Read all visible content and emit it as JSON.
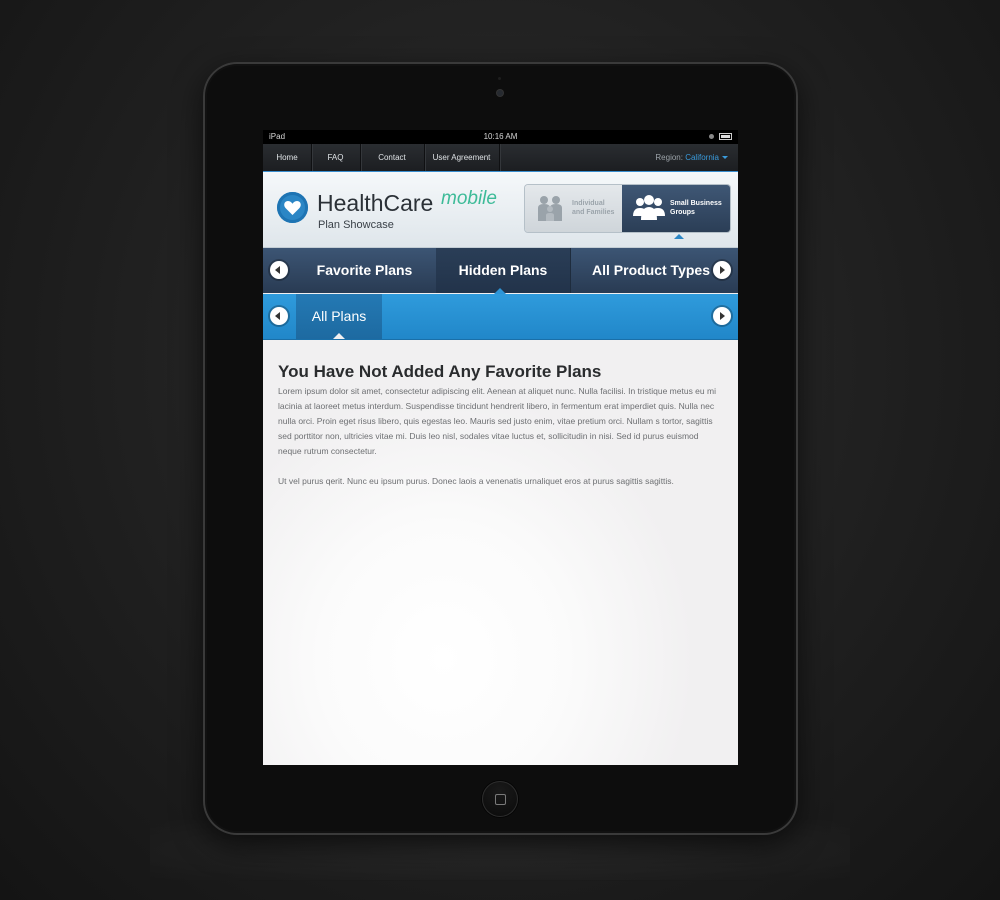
{
  "status_bar": {
    "carrier": "iPad",
    "time": "10:16 AM"
  },
  "top_nav": {
    "items": [
      {
        "label": "Home"
      },
      {
        "label": "FAQ"
      },
      {
        "label": "Contact"
      },
      {
        "label": "User Agreement"
      }
    ],
    "region_label": "Region:",
    "region_value": "California"
  },
  "brand": {
    "title": "HealthCare",
    "title_suffix": "mobile",
    "subtitle": "Plan Showcase"
  },
  "segments": {
    "individual": {
      "line1": "Individual",
      "line2": "and Families",
      "selected": false
    },
    "business": {
      "line1": "Small Business",
      "line2": "Groups",
      "selected": true
    }
  },
  "primary_tabs": [
    {
      "label": "Favorite Plans",
      "active": false
    },
    {
      "label": "Hidden Plans",
      "active": true
    },
    {
      "label": "All Product Types",
      "active": false
    }
  ],
  "secondary_tabs": [
    {
      "label": "All Plans",
      "active": true
    }
  ],
  "content": {
    "heading": "You Have Not Added Any Favorite Plans",
    "paragraph1": "Lorem ipsum dolor sit amet, consectetur adipiscing elit. Aenean at aliquet nunc. Nulla facilisi. In tristique metus eu mi lacinia at laoreet metus interdum. Suspendisse tincidunt hendrerit libero, in fermentum erat imperdiet quis. Nulla nec nulla orci. Proin eget risus libero, quis egestas leo. Mauris sed justo enim, vitae pretium orci. Nullam s tortor, sagittis sed porttitor non, ultricies vitae mi. Duis leo nisl, sodales vitae luctus et, sollicitudin in nisi. Sed id purus euismod neque rutrum consectetur.",
    "paragraph2": "Ut vel purus qerit. Nunc eu ipsum purus. Donec laois a venenatis urnaliquet eros at purus sagittis sagittis."
  },
  "colors": {
    "accent": "#2d94d6",
    "brand_green": "#3dbb98",
    "nav_dark": "#2b3e56"
  }
}
